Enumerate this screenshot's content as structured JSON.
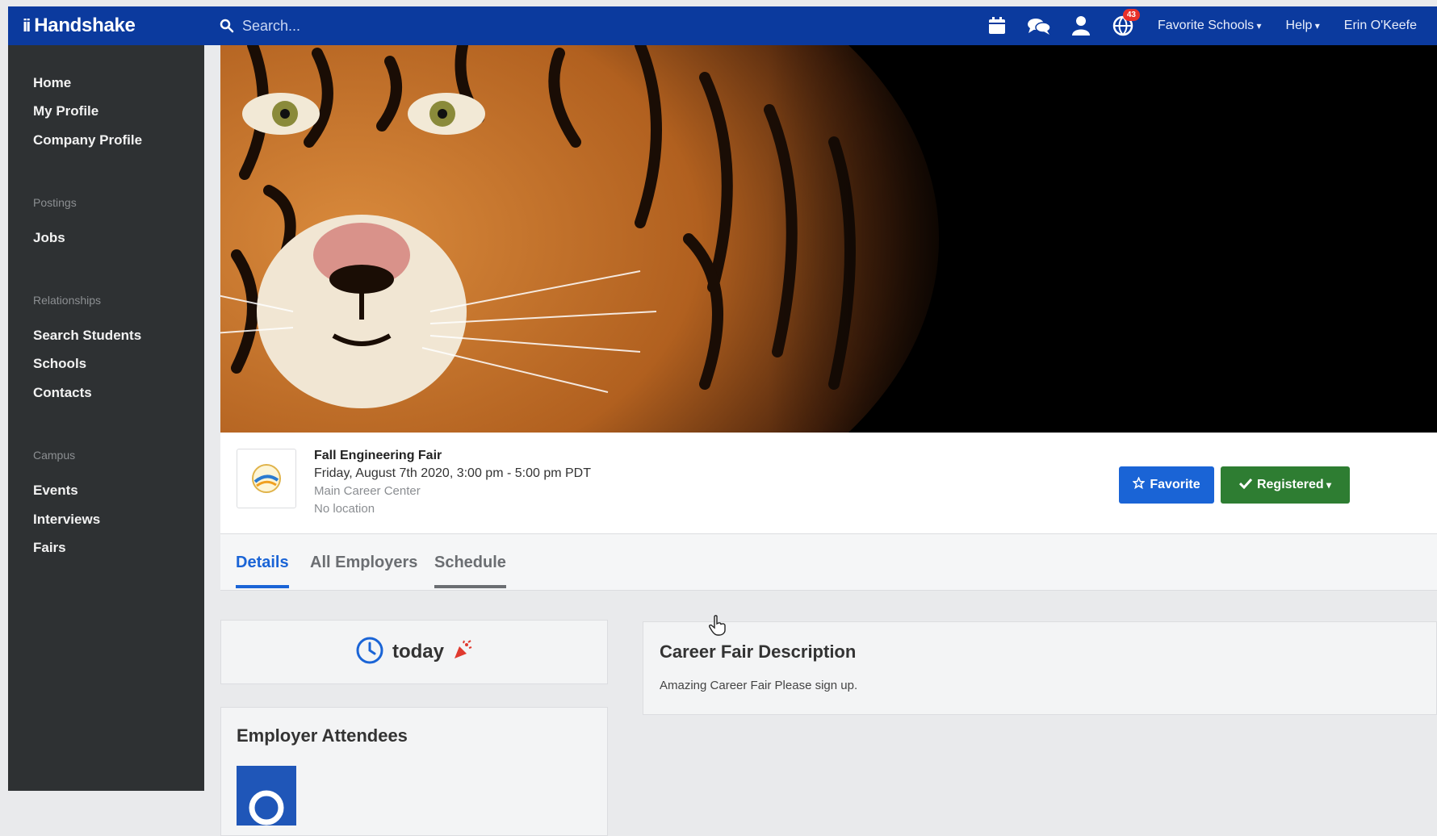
{
  "app": {
    "brand": "Handshake",
    "brand_mark": "ii"
  },
  "search": {
    "placeholder": "Search..."
  },
  "topnav": {
    "notification_count": "43",
    "menus": [
      "Favorite Schools",
      "Help",
      "Erin O'Keefe"
    ],
    "icons": [
      "calendar-icon",
      "chat-icon",
      "user-icon",
      "globe-icon"
    ]
  },
  "sidebar": {
    "items": [
      {
        "type": "link",
        "label": "Home"
      },
      {
        "type": "link",
        "label": "My Profile"
      },
      {
        "type": "link",
        "label": "Company Profile"
      },
      {
        "type": "heading",
        "label": "Postings"
      },
      {
        "type": "link",
        "label": "Jobs"
      },
      {
        "type": "heading",
        "label": "Relationships"
      },
      {
        "type": "link",
        "label": "Search Students"
      },
      {
        "type": "link",
        "label": "Schools"
      },
      {
        "type": "link",
        "label": "Contacts"
      },
      {
        "type": "heading",
        "label": "Campus"
      },
      {
        "type": "link",
        "label": "Events"
      },
      {
        "type": "link",
        "label": "Interviews"
      },
      {
        "type": "link",
        "label": "Fairs"
      }
    ]
  },
  "event": {
    "title": "Fall Engineering Fair",
    "datetime": "Friday, August 7th 2020, 3:00 pm - 5:00 pm PDT",
    "location": "Main Career Center",
    "no_location": "No location",
    "favorite_label": "Favorite",
    "registered_label": "Registered"
  },
  "tabs": [
    {
      "label": "Details",
      "active": true
    },
    {
      "label": "All Employers",
      "active": false
    },
    {
      "label": "Schedule",
      "active": false
    }
  ],
  "today": {
    "label": "today"
  },
  "attendees": {
    "title": "Employer Attendees"
  },
  "description": {
    "title": "Career Fair Description",
    "text": "Amazing Career Fair Please sign up."
  },
  "colors": {
    "nav_bg": "#0b3a9e",
    "sidebar_bg": "#2e3133",
    "accent_blue": "#1a64d6",
    "registered_green": "#2e7d32"
  }
}
